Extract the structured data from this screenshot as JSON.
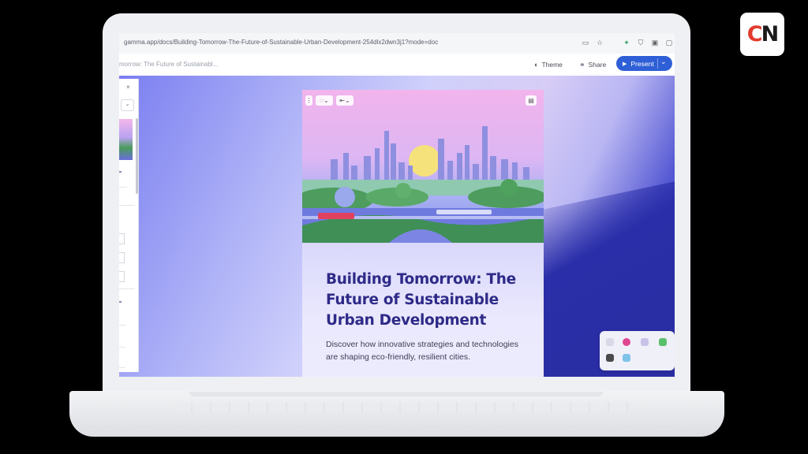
{
  "browser": {
    "url": "gamma.app/docs/Building-Tomorrow-The-Future-of-Sustainable-Urban-Development-254dlx2dwn3j1?mode=doc"
  },
  "app": {
    "doc_title": "morrow: The Future of Sustainabl...",
    "theme_label": "Theme",
    "share_label": "Share",
    "present_label": "Present"
  },
  "card": {
    "title": "Building Tomorrow: The Future of Sustainable Urban Development",
    "subtitle": "Discover how innovative strategies and technologies are shaping eco-friendly, resilient cities."
  },
  "logo": {
    "letter_c": "C",
    "letter_n": "N"
  },
  "icons": {
    "logo": "cn-logo",
    "theme": "palette-icon",
    "share": "link-icon",
    "present": "play-icon",
    "close": "close-icon"
  },
  "colors": {
    "accent": "#2f5fd6",
    "title": "#2e2a88",
    "logo_red": "#e23b2e"
  }
}
